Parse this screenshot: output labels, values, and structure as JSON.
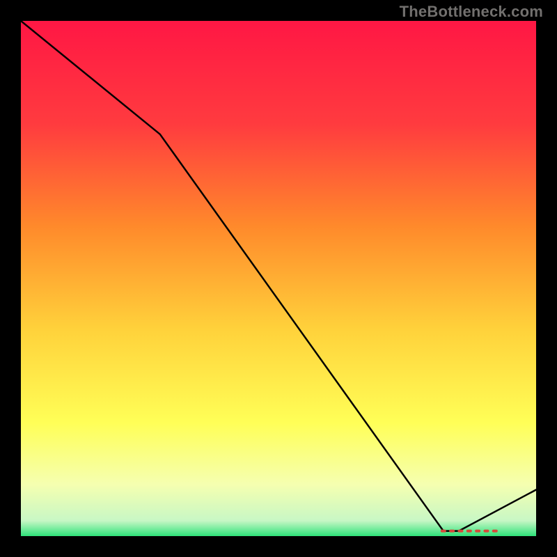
{
  "watermark": "TheBottleneck.com",
  "chart_data": {
    "type": "line",
    "title": "",
    "xlabel": "",
    "ylabel": "",
    "xlim": [
      0,
      100
    ],
    "ylim": [
      0,
      100
    ],
    "x": [
      0,
      27,
      82,
      85,
      100
    ],
    "values": [
      100,
      78,
      1,
      1,
      9
    ],
    "trough_marker_x_range": [
      82,
      92
    ],
    "gradient_stops": [
      {
        "offset": 0.0,
        "color": "#ff1744"
      },
      {
        "offset": 0.2,
        "color": "#ff3b3f"
      },
      {
        "offset": 0.4,
        "color": "#ff8a2b"
      },
      {
        "offset": 0.6,
        "color": "#ffd23b"
      },
      {
        "offset": 0.78,
        "color": "#ffff57"
      },
      {
        "offset": 0.9,
        "color": "#f5ffb0"
      },
      {
        "offset": 0.97,
        "color": "#c8f7c5"
      },
      {
        "offset": 1.0,
        "color": "#2ee27a"
      }
    ]
  }
}
